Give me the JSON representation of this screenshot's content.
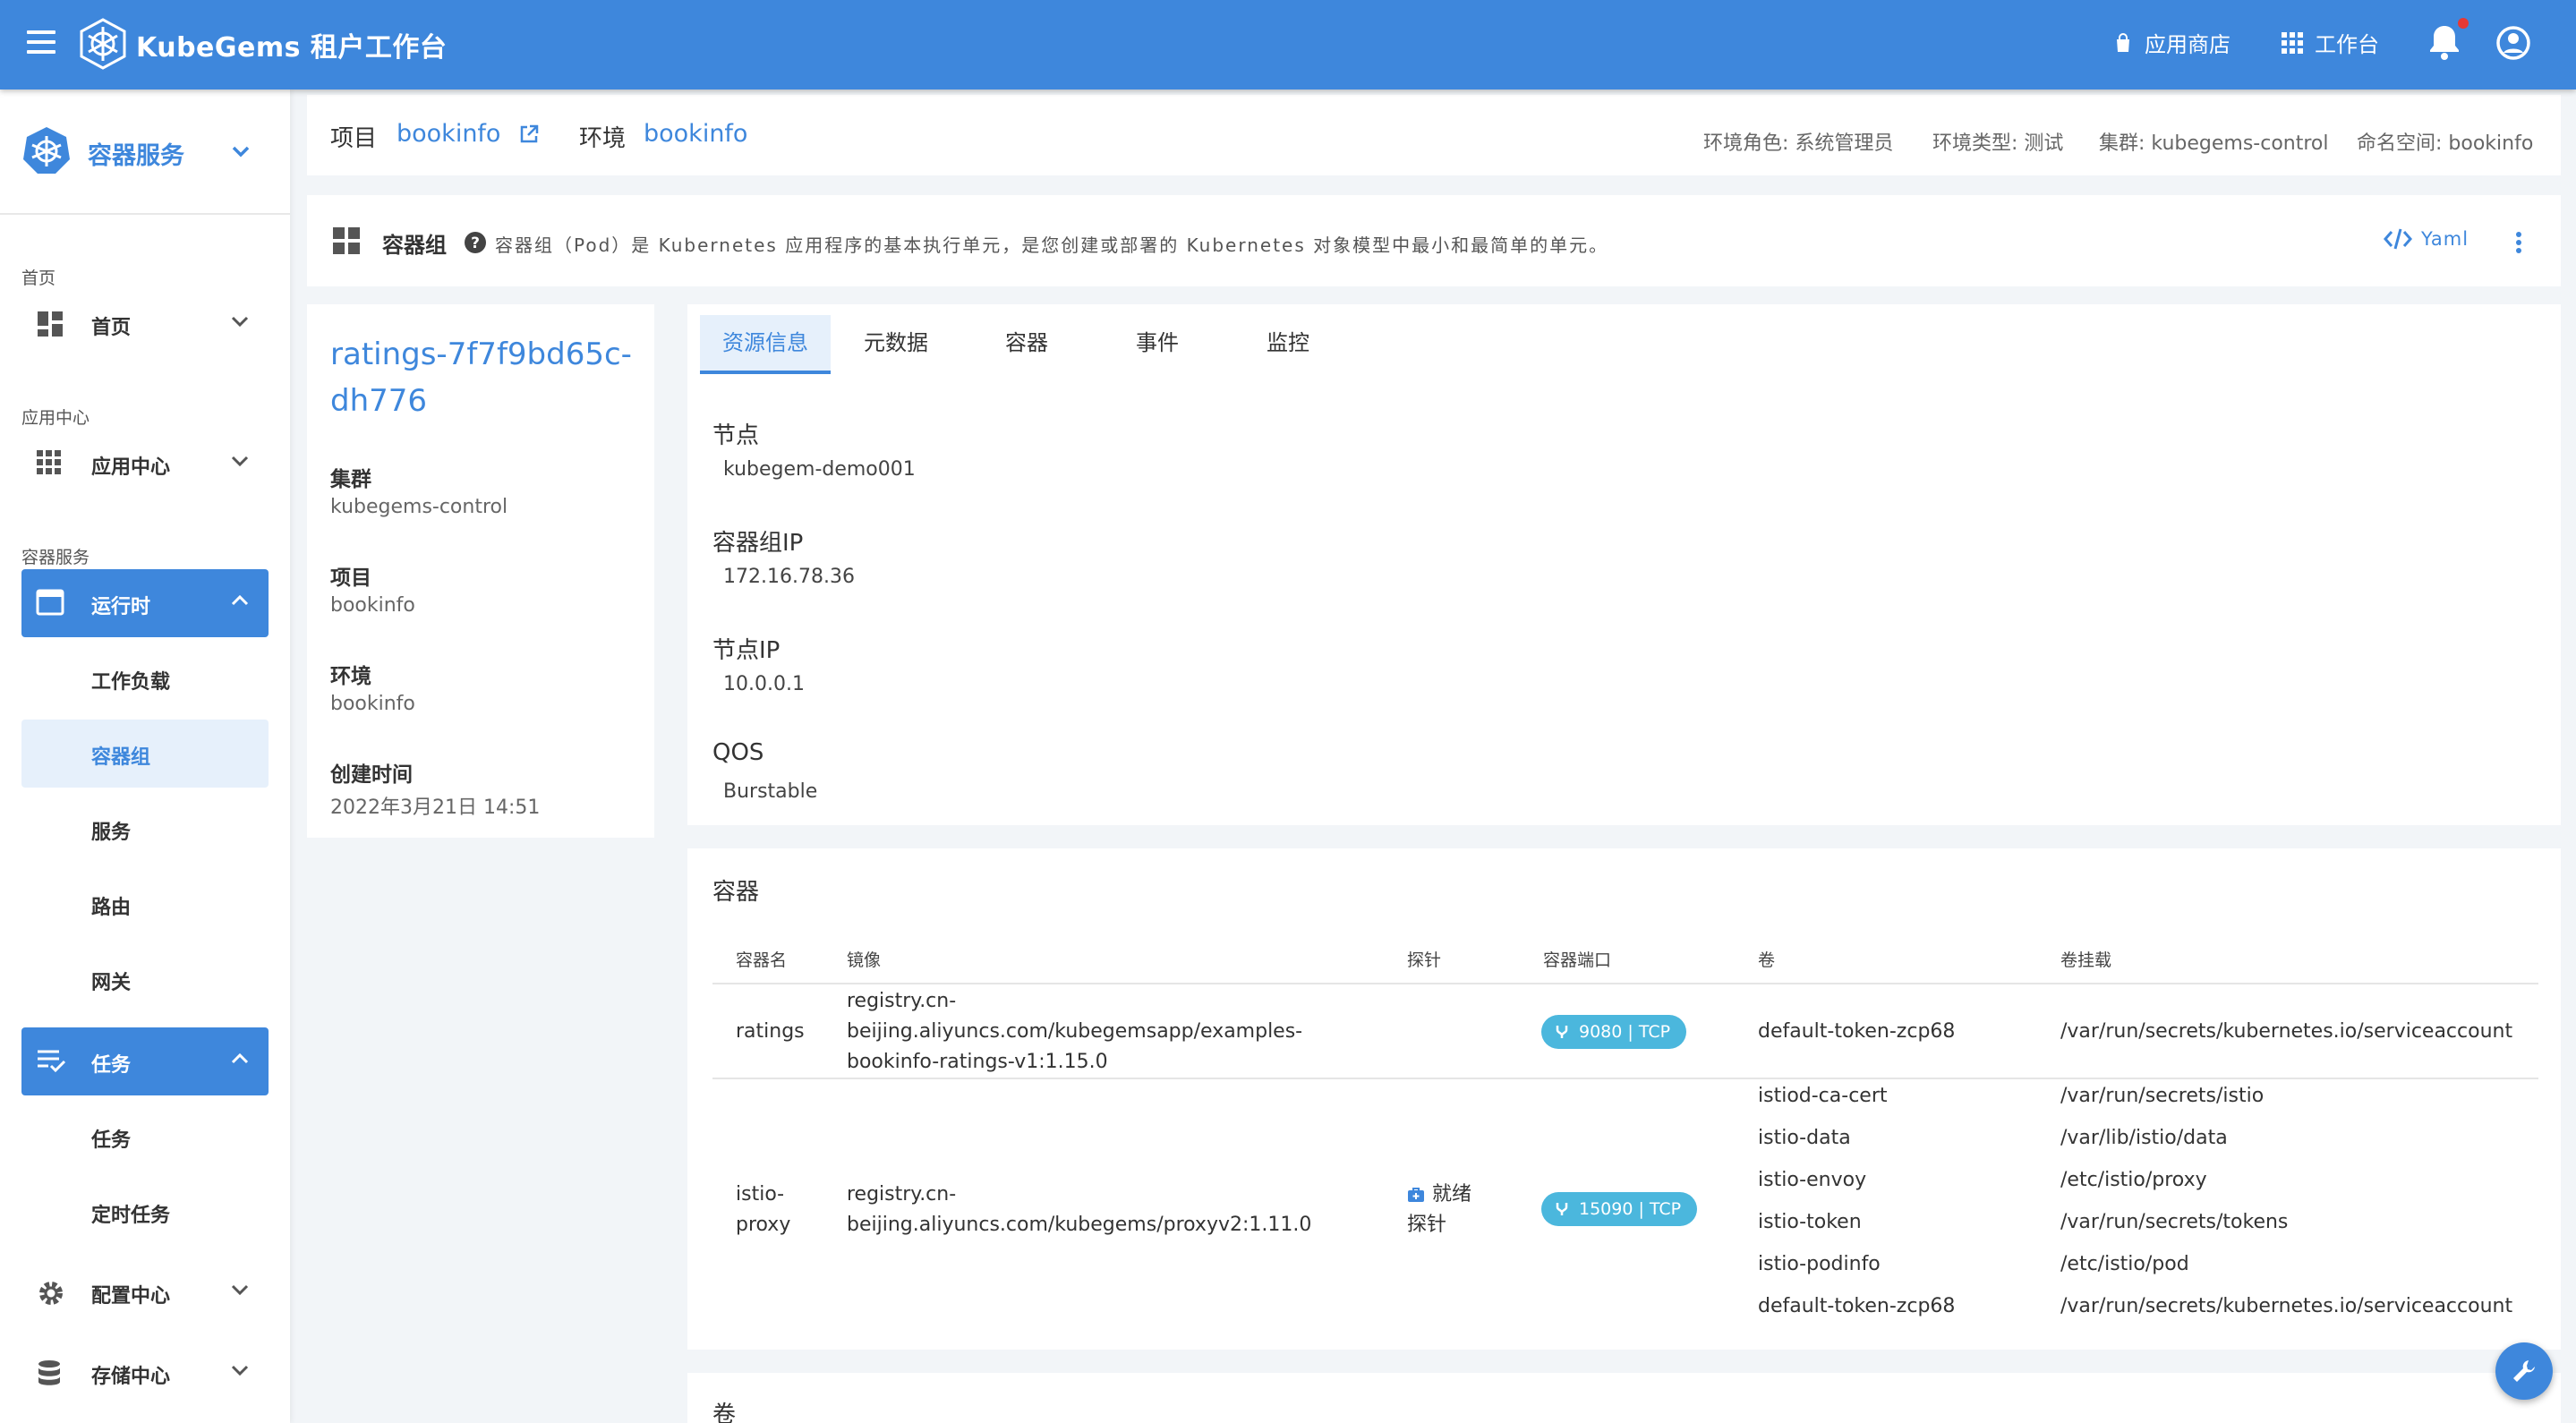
{
  "topbar": {
    "brand": "KubeGems 租户工作台",
    "app_store": "应用商店",
    "workbench": "工作台",
    "accent_color": "#3e87dc"
  },
  "sidebar": {
    "module_title": "容器服务",
    "sections": {
      "home": "首页",
      "app_center": "应用中心",
      "container_service": "容器服务"
    },
    "items": {
      "home": "首页",
      "app_center": "应用中心",
      "runtime": "运行时",
      "workload": "工作负载",
      "pod": "容器组",
      "service": "服务",
      "route": "路由",
      "gateway": "网关",
      "jobs": "任务",
      "job": "任务",
      "cronjob": "定时任务",
      "config": "配置中心",
      "storage": "存储中心"
    }
  },
  "project_bar": {
    "project_label": "项目",
    "project_value": "bookinfo",
    "env_label": "环境",
    "env_value": "bookinfo",
    "env_role": "环境角色: 系统管理员",
    "env_type": "环境类型: 测试",
    "cluster": "集群: kubegems-control",
    "namespace": "命名空间: bookinfo"
  },
  "pod_bar": {
    "title": "容器组",
    "description": "容器组（Pod）是 Kubernetes 应用程序的基本执行单元，是您创建或部署的 Kubernetes 对象模型中最小和最简单的单元。",
    "yaml": "Yaml"
  },
  "info_card": {
    "pod_name": "ratings-7f7f9bd65c-dh776",
    "cluster_label": "集群",
    "cluster_value": "kubegems-control",
    "project_label": "项目",
    "project_value": "bookinfo",
    "env_label": "环境",
    "env_value": "bookinfo",
    "created_label": "创建时间",
    "created_value": "2022年3月21日 14:51"
  },
  "tabs": [
    "资源信息",
    "元数据",
    "容器",
    "事件",
    "监控"
  ],
  "resource_info": {
    "node_label": "节点",
    "node_value": "kubegem-demo001",
    "pod_ip_label": "容器组IP",
    "pod_ip_value": "172.16.78.36",
    "node_ip_label": "节点IP",
    "node_ip_value": "10.0.0.1",
    "qos_label": "QOS",
    "qos_value": "Burstable"
  },
  "containers": {
    "title": "容器",
    "headers": {
      "name": "容器名",
      "image": "镜像",
      "probe": "探针",
      "ports": "容器端口",
      "volumes": "卷",
      "mounts": "卷挂载"
    },
    "rows": [
      {
        "name": "ratings",
        "image_1": "registry.cn-",
        "image_2": "beijing.aliyuncs.com/kubegemsapp/examples-",
        "image_3": "bookinfo-ratings-v1:1.15.0",
        "probe": "",
        "port": "9080 | TCP",
        "volumes": [
          "default-token-zcp68"
        ],
        "mounts": [
          "/var/run/secrets/kubernetes.io/serviceaccount"
        ]
      },
      {
        "name_1": "istio-",
        "name_2": "proxy",
        "image_1": "registry.cn-",
        "image_2": "beijing.aliyuncs.com/kubegems/proxyv2:1.11.0",
        "probe_1": "就绪",
        "probe_2": "探针",
        "port": "15090 | TCP",
        "volumes": [
          "istiod-ca-cert",
          "istio-data",
          "istio-envoy",
          "istio-token",
          "istio-podinfo",
          "default-token-zcp68"
        ],
        "mounts": [
          "/var/run/secrets/istio",
          "/var/lib/istio/data",
          "/etc/istio/proxy",
          "/var/run/secrets/tokens",
          "/etc/istio/pod",
          "/var/run/secrets/kubernetes.io/serviceaccount"
        ]
      }
    ]
  },
  "volumes_card": {
    "title": "卷"
  }
}
